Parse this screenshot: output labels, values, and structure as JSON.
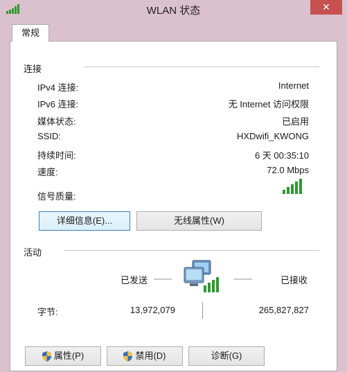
{
  "window": {
    "title": "WLAN 状态",
    "close_glyph": "✕"
  },
  "tab": {
    "label": "常规"
  },
  "connection": {
    "section_label": "连接",
    "rows": [
      {
        "label": "IPv4 连接:",
        "value": "Internet"
      },
      {
        "label": "IPv6 连接:",
        "value": "无 Internet 访问权限"
      },
      {
        "label": "媒体状态:",
        "value": "已启用"
      },
      {
        "label": "SSID:",
        "value": "HXDwifi_KWONG"
      },
      {
        "label": "持续时间:",
        "value": "6 天 00:35:10"
      },
      {
        "label": "速度:",
        "value": "72.0 Mbps"
      }
    ],
    "signal_label": "信号质量:",
    "signal_icon": "signal-bars-icon",
    "signal_bars_lit": 5,
    "signal_bars_total": 5,
    "details_button": "详细信息(E)...",
    "wireless_props_button": "无线属性(W)"
  },
  "activity": {
    "section_label": "活动",
    "sent_label": "已发送",
    "received_label": "已接收",
    "network_icon": "network-computers-icon",
    "bytes_label": "字节:",
    "bytes_sent": "13,972,079",
    "bytes_received": "265,827,827"
  },
  "buttons": {
    "properties": "属性(P)",
    "disable": "禁用(D)",
    "diagnose": "诊断(G)"
  },
  "colors": {
    "window_frame": "#dbc0cd",
    "close_button": "#c75050",
    "signal_green": "#2e9a2e",
    "focus_border": "#3c7fb1"
  }
}
